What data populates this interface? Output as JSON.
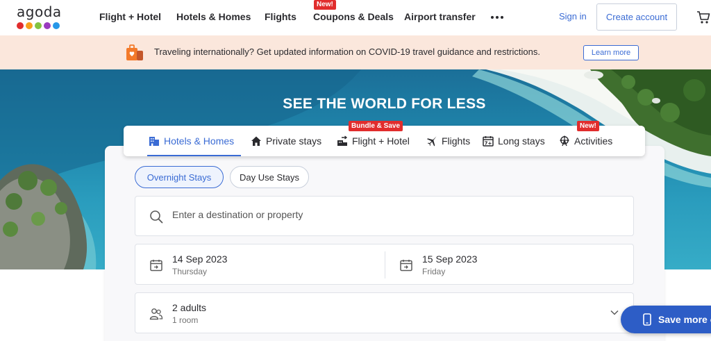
{
  "brand": {
    "logo_text": "agoda",
    "dot_colors": [
      "#e12d2d",
      "#f7a01c",
      "#83c340",
      "#9a3bbf",
      "#2797e8"
    ]
  },
  "header": {
    "nav": [
      {
        "label": "Flight + Hotel"
      },
      {
        "label": "Hotels & Homes"
      },
      {
        "label": "Flights"
      },
      {
        "label": "Coupons & Deals",
        "badge": "New!"
      },
      {
        "label": "Airport transfer"
      }
    ],
    "more_icon": "more-dots-icon",
    "sign_in": "Sign in",
    "create_account": "Create account",
    "cart_icon": "cart-icon"
  },
  "banner": {
    "icon": "luggage-icon",
    "text": "Traveling internationally? Get updated information on COVID-19 travel guidance and restrictions.",
    "learn_more": "Learn more"
  },
  "hero": {
    "title": "SEE THE WORLD FOR LESS"
  },
  "tabs": [
    {
      "label": "Hotels & Homes",
      "icon": "building-icon",
      "active": true
    },
    {
      "label": "Private stays",
      "icon": "house-icon"
    },
    {
      "label": "Flight + Hotel",
      "icon": "bundle-icon",
      "badge": "Bundle & Save"
    },
    {
      "label": "Flights",
      "icon": "plane-icon"
    },
    {
      "label": "Long stays",
      "icon": "calendar-7-icon"
    },
    {
      "label": "Activities",
      "icon": "ferris-wheel-icon",
      "badge": "New!"
    }
  ],
  "stay_types": {
    "selected": "Overnight Stays",
    "other": "Day Use Stays"
  },
  "search": {
    "placeholder": "Enter a destination or property",
    "value": ""
  },
  "dates": {
    "check_in": {
      "date": "14 Sep 2023",
      "day": "Thursday"
    },
    "check_out": {
      "date": "15 Sep 2023",
      "day": "Friday"
    }
  },
  "guests": {
    "adults": "2 adults",
    "rooms": "1 room"
  },
  "floating_button": {
    "label": "Save more on app"
  },
  "colors": {
    "accent": "#3a6bd4",
    "badge_red": "#e12d2d",
    "banner_bg": "#fbe7dc",
    "app_button": "#2d5dc6"
  }
}
